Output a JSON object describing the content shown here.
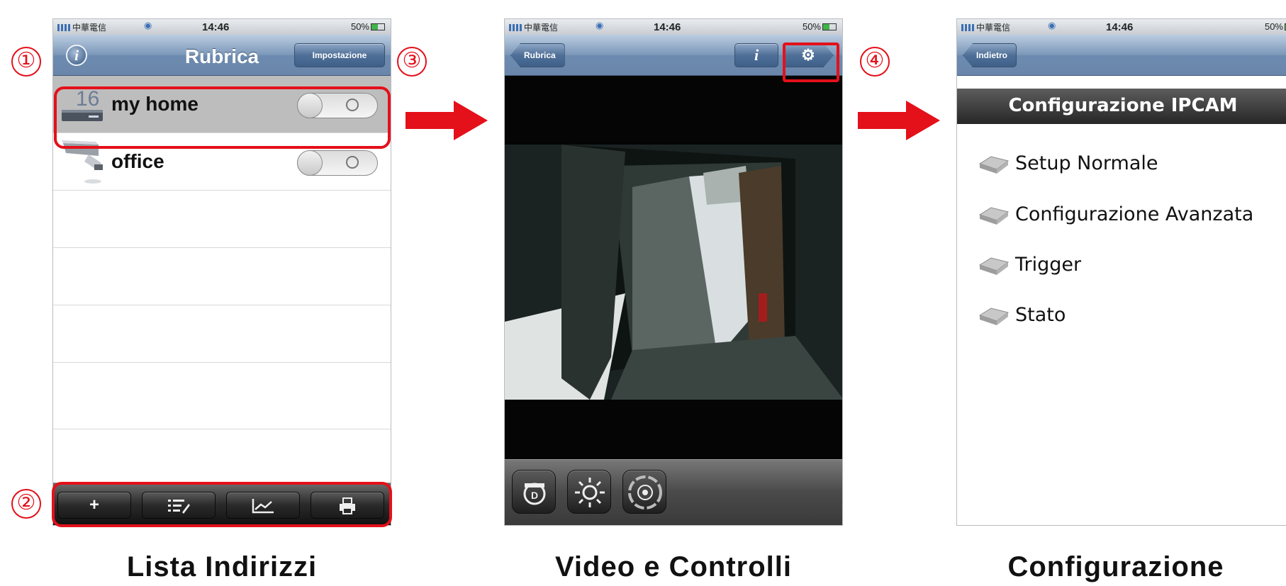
{
  "status_bar": {
    "carrier": "中華電信",
    "time": "14:46",
    "battery": "50%"
  },
  "screen1": {
    "nav_title": "Rubrica",
    "info_icon": "i",
    "settings_button": "Impostazione",
    "devices": [
      {
        "name": "my home",
        "icon_text": "16"
      },
      {
        "name": "office"
      }
    ],
    "toolbar": {
      "add": "+",
      "edit": "edit-list-icon",
      "stats": "chart-icon",
      "print": "print-icon"
    },
    "caption": "Lista Indirizzi"
  },
  "screen2": {
    "back_button": "Rubrica",
    "info_icon": "i",
    "caption": "Video e Controlli"
  },
  "screen3": {
    "back_button": "Indietro",
    "section_title": "Configurazione IPCAM",
    "menu": [
      "Setup Normale",
      "Configurazione Avanzata",
      "Trigger",
      "Stato"
    ],
    "caption": "Configurazione"
  },
  "markers": [
    "①",
    "②",
    "③",
    "④"
  ],
  "colors": {
    "highlight": "#e4101a",
    "navbar": "#6d8bb0"
  }
}
